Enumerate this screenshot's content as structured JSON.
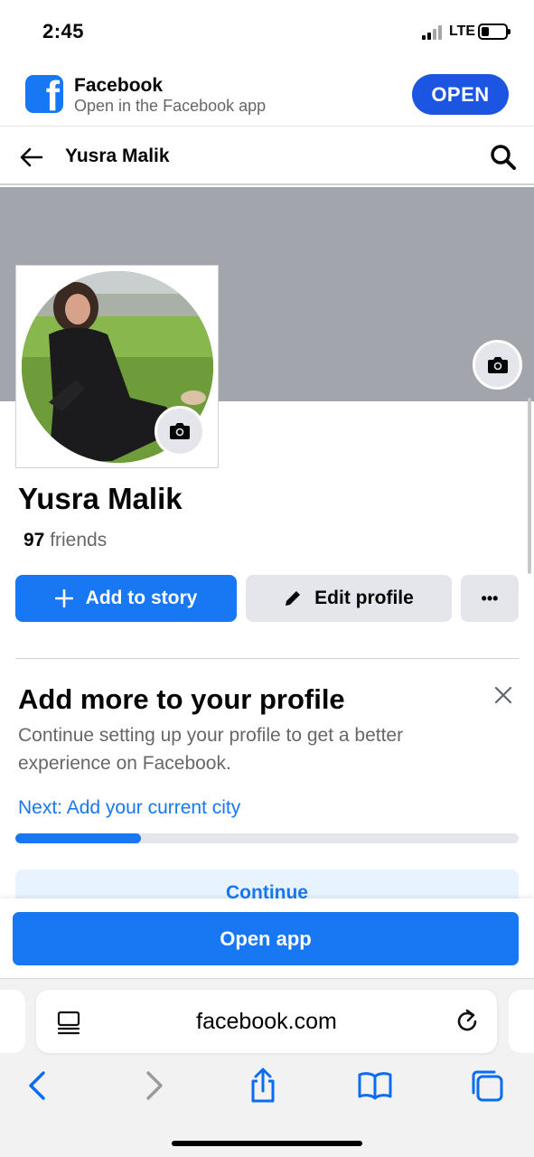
{
  "status_bar": {
    "time": "2:45",
    "network": "LTE"
  },
  "app_banner": {
    "title": "Facebook",
    "subtitle": "Open in the Facebook app",
    "open_label": "OPEN"
  },
  "nav": {
    "title": "Yusra Malik"
  },
  "profile": {
    "name": "Yusra Malik",
    "friends_count": "97",
    "friends_label": " friends"
  },
  "actions": {
    "add_story": "Add to story",
    "edit_profile": "Edit profile",
    "more": "•••"
  },
  "card": {
    "title": "Add more to your profile",
    "body": "Continue setting up your profile to get a better experience on Facebook.",
    "next": "Next: Add your current city",
    "progress": 0.25,
    "continue_label": "Continue"
  },
  "sticky": {
    "open_app_label": "Open app"
  },
  "browser": {
    "url": "facebook.com"
  },
  "colors": {
    "brand": "#1877f2",
    "open_button": "#1b55e2",
    "cover": "#a2a6ac"
  },
  "icons": [
    "facebook-logo-icon",
    "back-arrow-icon",
    "search-icon",
    "camera-icon",
    "plus-icon",
    "pencil-icon",
    "close-icon",
    "reader-icon",
    "reload-icon",
    "back-chevron-icon",
    "forward-chevron-icon",
    "share-icon",
    "bookmarks-icon",
    "tabs-icon"
  ]
}
